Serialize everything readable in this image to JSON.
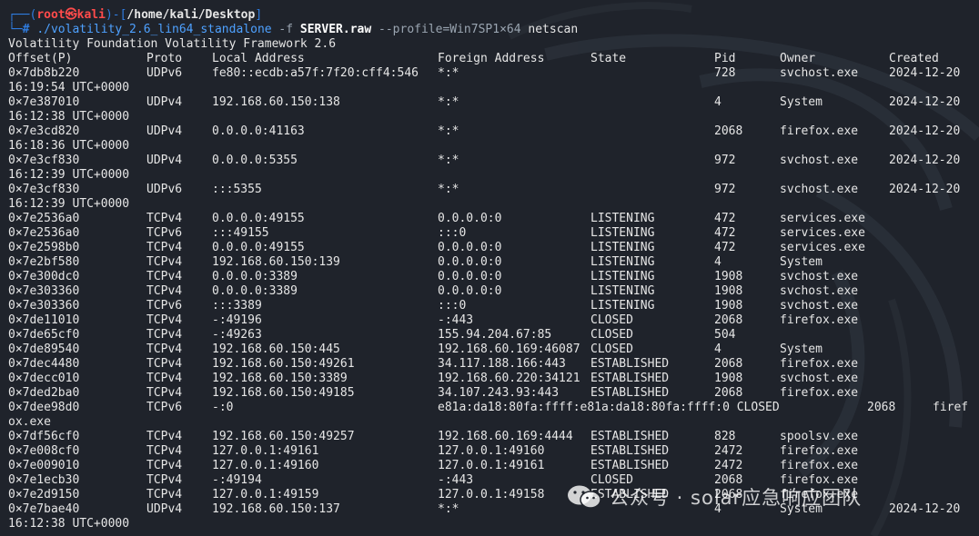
{
  "prompt": {
    "open": "┌──(",
    "user": "root㉿kali",
    "mid": ")-[",
    "path": "/home/kali/Desktop",
    "close": "]",
    "hash": "└─#",
    "cmd": "./volatility_2.6_lin64_standalone",
    "flag_f": "-f",
    "file": "SERVER.raw",
    "profile": "--profile=Win7SP1×64",
    "plugin": "netscan"
  },
  "banner": "Volatility Foundation Volatility Framework 2.6",
  "headers": [
    "Offset(P)",
    "Proto",
    "Local Address",
    "Foreign Address",
    "State",
    "Pid",
    "Owner",
    "Created"
  ],
  "rows": [
    {
      "offset": "0×7db8b220",
      "proto": "UDPv6",
      "local": "fe80::ecdb:a57f:7f20:cff4:546",
      "foreign": "*:*",
      "state": "",
      "pid": "728",
      "owner": "svchost.exe",
      "created": "2024-12-20",
      "created2": "16:19:54 UTC+0000"
    },
    {
      "offset": "0×7e387010",
      "proto": "UDPv4",
      "local": "192.168.60.150:138",
      "foreign": "*:*",
      "state": "",
      "pid": "4",
      "owner": "System",
      "created": "2024-12-20",
      "created2": "16:12:38 UTC+0000"
    },
    {
      "offset": "0×7e3cd820",
      "proto": "UDPv4",
      "local": "0.0.0.0:41163",
      "foreign": "*:*",
      "state": "",
      "pid": "2068",
      "owner": "firefox.exe",
      "created": "2024-12-20",
      "created2": "16:18:36 UTC+0000"
    },
    {
      "offset": "0×7e3cf830",
      "proto": "UDPv4",
      "local": "0.0.0.0:5355",
      "foreign": "*:*",
      "state": "",
      "pid": "972",
      "owner": "svchost.exe",
      "created": "2024-12-20",
      "created2": "16:12:39 UTC+0000"
    },
    {
      "offset": "0×7e3cf830",
      "proto": "UDPv6",
      "local": ":::5355",
      "foreign": "*:*",
      "state": "",
      "pid": "972",
      "owner": "svchost.exe",
      "created": "2024-12-20",
      "created2": "16:12:39 UTC+0000"
    },
    {
      "offset": "0×7e2536a0",
      "proto": "TCPv4",
      "local": "0.0.0.0:49155",
      "foreign": "0.0.0.0:0",
      "state": "LISTENING",
      "pid": "472",
      "owner": "services.exe",
      "created": ""
    },
    {
      "offset": "0×7e2536a0",
      "proto": "TCPv6",
      "local": ":::49155",
      "foreign": ":::0",
      "state": "LISTENING",
      "pid": "472",
      "owner": "services.exe",
      "created": ""
    },
    {
      "offset": "0×7e2598b0",
      "proto": "TCPv4",
      "local": "0.0.0.0:49155",
      "foreign": "0.0.0.0:0",
      "state": "LISTENING",
      "pid": "472",
      "owner": "services.exe",
      "created": ""
    },
    {
      "offset": "0×7e2bf580",
      "proto": "TCPv4",
      "local": "192.168.60.150:139",
      "foreign": "0.0.0.0:0",
      "state": "LISTENING",
      "pid": "4",
      "owner": "System",
      "created": ""
    },
    {
      "offset": "0×7e300dc0",
      "proto": "TCPv4",
      "local": "0.0.0.0:3389",
      "foreign": "0.0.0.0:0",
      "state": "LISTENING",
      "pid": "1908",
      "owner": "svchost.exe",
      "created": ""
    },
    {
      "offset": "0×7e303360",
      "proto": "TCPv4",
      "local": "0.0.0.0:3389",
      "foreign": "0.0.0.0:0",
      "state": "LISTENING",
      "pid": "1908",
      "owner": "svchost.exe",
      "created": ""
    },
    {
      "offset": "0×7e303360",
      "proto": "TCPv6",
      "local": ":::3389",
      "foreign": ":::0",
      "state": "LISTENING",
      "pid": "1908",
      "owner": "svchost.exe",
      "created": ""
    },
    {
      "offset": "0×7de11010",
      "proto": "TCPv4",
      "local": "-:49196",
      "foreign": "-:443",
      "state": "CLOSED",
      "pid": "2068",
      "owner": "firefox.exe",
      "created": ""
    },
    {
      "offset": "0×7de65cf0",
      "proto": "TCPv4",
      "local": "-:49263",
      "foreign": "155.94.204.67:85",
      "state": "CLOSED",
      "pid": "504",
      "owner": "",
      "created": ""
    },
    {
      "offset": "0×7de89540",
      "proto": "TCPv4",
      "local": "192.168.60.150:445",
      "foreign": "192.168.60.169:46087",
      "state": "CLOSED",
      "pid": "4",
      "owner": "System",
      "created": ""
    },
    {
      "offset": "0×7dec4480",
      "proto": "TCPv4",
      "local": "192.168.60.150:49261",
      "foreign": "34.117.188.166:443",
      "state": "ESTABLISHED",
      "pid": "2068",
      "owner": "firefox.exe",
      "created": ""
    },
    {
      "offset": "0×7decc010",
      "proto": "TCPv4",
      "local": "192.168.60.150:3389",
      "foreign": "192.168.60.220:34121",
      "state": "ESTABLISHED",
      "pid": "1908",
      "owner": "svchost.exe",
      "created": ""
    },
    {
      "offset": "0×7ded2ba0",
      "proto": "TCPv4",
      "local": "192.168.60.150:49185",
      "foreign": "34.107.243.93:443",
      "state": "ESTABLISHED",
      "pid": "2068",
      "owner": "firefox.exe",
      "created": ""
    },
    {
      "offset": "0×7dee98d0",
      "proto": "TCPv6",
      "local": "-:0",
      "foreign": "e81a:da18:80fa:ffff:e81a:da18:80fa:ffff:0 CLOSED",
      "state": "",
      "pid": "2068",
      "owner": "firef",
      "created": "",
      "wrap": "ox.exe"
    },
    {
      "offset": "0×7df56cf0",
      "proto": "TCPv4",
      "local": "192.168.60.150:49257",
      "foreign": "192.168.60.169:4444",
      "state": "ESTABLISHED",
      "pid": "828",
      "owner": "spoolsv.exe",
      "created": ""
    },
    {
      "offset": "0×7e008cf0",
      "proto": "TCPv4",
      "local": "127.0.0.1:49161",
      "foreign": "127.0.0.1:49160",
      "state": "ESTABLISHED",
      "pid": "2472",
      "owner": "firefox.exe",
      "created": ""
    },
    {
      "offset": "0×7e009010",
      "proto": "TCPv4",
      "local": "127.0.0.1:49160",
      "foreign": "127.0.0.1:49161",
      "state": "ESTABLISHED",
      "pid": "2472",
      "owner": "firefox.exe",
      "created": ""
    },
    {
      "offset": "0×7e1ecb30",
      "proto": "TCPv4",
      "local": "-:49194",
      "foreign": "-:443",
      "state": "CLOSED",
      "pid": "2068",
      "owner": "firefox.exe",
      "created": ""
    },
    {
      "offset": "0×7e2d9150",
      "proto": "TCPv4",
      "local": "127.0.0.1:49159",
      "foreign": "127.0.0.1:49158",
      "state": "ESTABLISHED",
      "pid": "2068",
      "owner": "firefox.exe",
      "created": ""
    },
    {
      "offset": "0×7e7bae40",
      "proto": "UDPv4",
      "local": "192.168.60.150:137",
      "foreign": "*:*",
      "state": "",
      "pid": "4",
      "owner": "System",
      "created": "2024-12-20",
      "created2": "16:12:38 UTC+0000"
    }
  ],
  "watermark": "公众号 · solar应急响应团队",
  "colors": {
    "background": "#1f232b",
    "prompt": "#2f7de1",
    "user": "#ff4b4b",
    "command": "#4ea1ff"
  }
}
